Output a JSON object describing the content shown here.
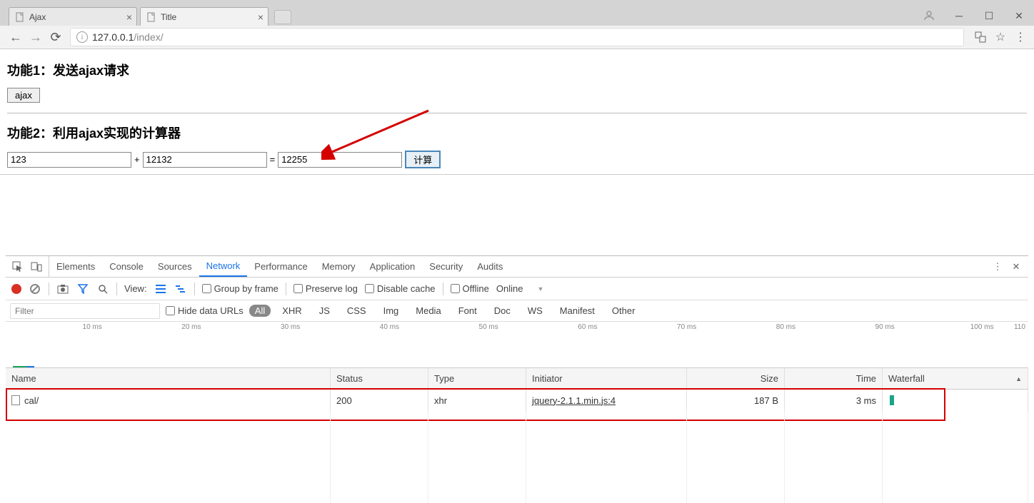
{
  "browser": {
    "tabs": [
      {
        "title": "Ajax",
        "active": false
      },
      {
        "title": "Title",
        "active": true
      }
    ],
    "url_host": "127.0.0.1",
    "url_path": "/index/"
  },
  "page": {
    "heading1": "功能1：发送ajax请求",
    "button1": "ajax",
    "heading2": "功能2：利用ajax实现的计算器",
    "calc": {
      "a": "123",
      "op": "+",
      "b": "12132",
      "eq": "=",
      "result": "12255",
      "calc_btn": "计算"
    }
  },
  "devtools": {
    "panels": [
      "Elements",
      "Console",
      "Sources",
      "Network",
      "Performance",
      "Memory",
      "Application",
      "Security",
      "Audits"
    ],
    "active_panel": "Network",
    "toolbar": {
      "view_label": "View:",
      "group_by_frame": "Group by frame",
      "preserve_log": "Preserve log",
      "disable_cache": "Disable cache",
      "offline": "Offline",
      "online": "Online"
    },
    "filter": {
      "placeholder": "Filter",
      "hide_data_urls": "Hide data URLs",
      "types": [
        "All",
        "XHR",
        "JS",
        "CSS",
        "Img",
        "Media",
        "Font",
        "Doc",
        "WS",
        "Manifest",
        "Other"
      ],
      "active_type": "All"
    },
    "timeline_ticks": [
      "10 ms",
      "20 ms",
      "30 ms",
      "40 ms",
      "50 ms",
      "60 ms",
      "70 ms",
      "80 ms",
      "90 ms",
      "100 ms",
      "110"
    ],
    "columns": {
      "name": "Name",
      "status": "Status",
      "type": "Type",
      "initiator": "Initiator",
      "size": "Size",
      "time": "Time",
      "waterfall": "Waterfall"
    },
    "rows": [
      {
        "name": "cal/",
        "status": "200",
        "type": "xhr",
        "initiator": "jquery-2.1.1.min.js:4",
        "size": "187 B",
        "time": "3 ms"
      }
    ]
  }
}
